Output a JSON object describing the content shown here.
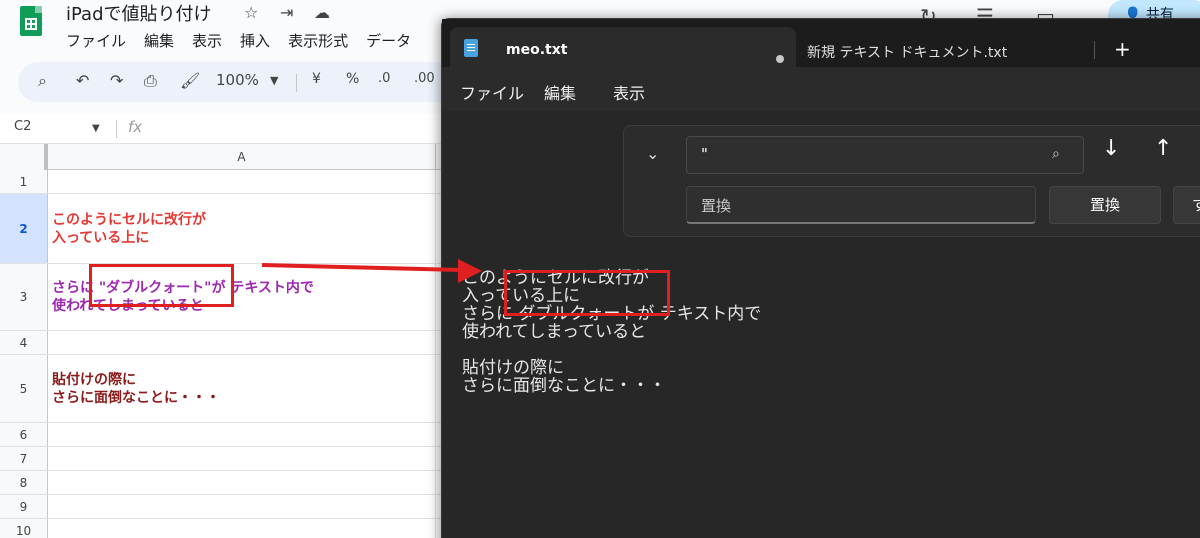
{
  "sheets": {
    "doc_title": "iPadで値貼り付け",
    "menu": [
      "ファイル",
      "編集",
      "表示",
      "挿入",
      "表示形式",
      "データ"
    ],
    "zoom": "100%",
    "currency": "¥",
    "percent": "%",
    "dec_dec": ".0",
    "dec_inc": ".00",
    "namebox": "C2",
    "fx": "fx",
    "share_label": "共有",
    "column_a": "A",
    "rows": [
      {
        "num": "1",
        "lines": []
      },
      {
        "num": "2",
        "lines": [
          "このようにセルに改行が",
          "入っている上に"
        ]
      },
      {
        "num": "3",
        "lines": [
          "さらに \"ダブルクォート\"が テキスト内で",
          "使われてしまっていると"
        ]
      },
      {
        "num": "4",
        "lines": []
      },
      {
        "num": "5",
        "lines": [
          "貼付けの際に",
          "さらに面倒なことに・・・"
        ]
      },
      {
        "num": "6",
        "lines": []
      },
      {
        "num": "7",
        "lines": []
      },
      {
        "num": "8",
        "lines": []
      },
      {
        "num": "9",
        "lines": []
      },
      {
        "num": "10",
        "lines": []
      }
    ]
  },
  "notepad": {
    "tab_active": "meo.txt",
    "tab_other": "新規 テキスト ドキュメント.txt",
    "menu": [
      "ファイル",
      "編集",
      "表示"
    ],
    "find_value": "\"",
    "replace_placeholder": "置換",
    "replace_button": "置換",
    "replace_all_partial": "す",
    "content_lines": [
      "このようにセルに改行が",
      "入っている上に",
      "さらに ダブルクォートが テキスト内で",
      "使われてしまっていると",
      "",
      "貼付けの際に",
      "さらに面倒なことに・・・"
    ]
  },
  "colors": {
    "annotation_red": "#e02020",
    "cell_red": "#e53935",
    "cell_purple": "#9c27b0",
    "cell_maroon": "#8b1a1a",
    "notepad_bg": "#272727"
  }
}
